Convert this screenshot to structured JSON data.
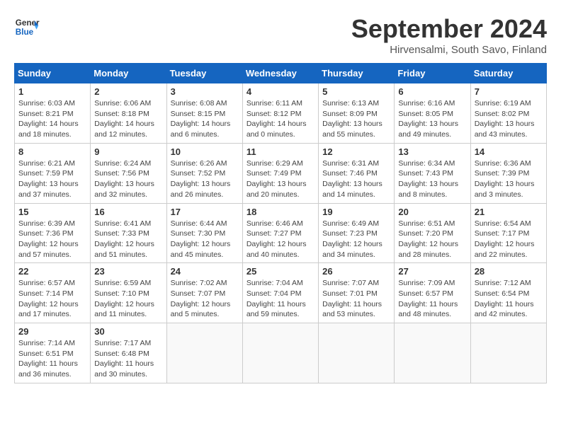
{
  "header": {
    "logo_line1": "General",
    "logo_line2": "Blue",
    "month": "September 2024",
    "location": "Hirvensalmi, South Savo, Finland"
  },
  "weekdays": [
    "Sunday",
    "Monday",
    "Tuesday",
    "Wednesday",
    "Thursday",
    "Friday",
    "Saturday"
  ],
  "weeks": [
    [
      {
        "day": "1",
        "info": "Sunrise: 6:03 AM\nSunset: 8:21 PM\nDaylight: 14 hours\nand 18 minutes."
      },
      {
        "day": "2",
        "info": "Sunrise: 6:06 AM\nSunset: 8:18 PM\nDaylight: 14 hours\nand 12 minutes."
      },
      {
        "day": "3",
        "info": "Sunrise: 6:08 AM\nSunset: 8:15 PM\nDaylight: 14 hours\nand 6 minutes."
      },
      {
        "day": "4",
        "info": "Sunrise: 6:11 AM\nSunset: 8:12 PM\nDaylight: 14 hours\nand 0 minutes."
      },
      {
        "day": "5",
        "info": "Sunrise: 6:13 AM\nSunset: 8:09 PM\nDaylight: 13 hours\nand 55 minutes."
      },
      {
        "day": "6",
        "info": "Sunrise: 6:16 AM\nSunset: 8:05 PM\nDaylight: 13 hours\nand 49 minutes."
      },
      {
        "day": "7",
        "info": "Sunrise: 6:19 AM\nSunset: 8:02 PM\nDaylight: 13 hours\nand 43 minutes."
      }
    ],
    [
      {
        "day": "8",
        "info": "Sunrise: 6:21 AM\nSunset: 7:59 PM\nDaylight: 13 hours\nand 37 minutes."
      },
      {
        "day": "9",
        "info": "Sunrise: 6:24 AM\nSunset: 7:56 PM\nDaylight: 13 hours\nand 32 minutes."
      },
      {
        "day": "10",
        "info": "Sunrise: 6:26 AM\nSunset: 7:52 PM\nDaylight: 13 hours\nand 26 minutes."
      },
      {
        "day": "11",
        "info": "Sunrise: 6:29 AM\nSunset: 7:49 PM\nDaylight: 13 hours\nand 20 minutes."
      },
      {
        "day": "12",
        "info": "Sunrise: 6:31 AM\nSunset: 7:46 PM\nDaylight: 13 hours\nand 14 minutes."
      },
      {
        "day": "13",
        "info": "Sunrise: 6:34 AM\nSunset: 7:43 PM\nDaylight: 13 hours\nand 8 minutes."
      },
      {
        "day": "14",
        "info": "Sunrise: 6:36 AM\nSunset: 7:39 PM\nDaylight: 13 hours\nand 3 minutes."
      }
    ],
    [
      {
        "day": "15",
        "info": "Sunrise: 6:39 AM\nSunset: 7:36 PM\nDaylight: 12 hours\nand 57 minutes."
      },
      {
        "day": "16",
        "info": "Sunrise: 6:41 AM\nSunset: 7:33 PM\nDaylight: 12 hours\nand 51 minutes."
      },
      {
        "day": "17",
        "info": "Sunrise: 6:44 AM\nSunset: 7:30 PM\nDaylight: 12 hours\nand 45 minutes."
      },
      {
        "day": "18",
        "info": "Sunrise: 6:46 AM\nSunset: 7:27 PM\nDaylight: 12 hours\nand 40 minutes."
      },
      {
        "day": "19",
        "info": "Sunrise: 6:49 AM\nSunset: 7:23 PM\nDaylight: 12 hours\nand 34 minutes."
      },
      {
        "day": "20",
        "info": "Sunrise: 6:51 AM\nSunset: 7:20 PM\nDaylight: 12 hours\nand 28 minutes."
      },
      {
        "day": "21",
        "info": "Sunrise: 6:54 AM\nSunset: 7:17 PM\nDaylight: 12 hours\nand 22 minutes."
      }
    ],
    [
      {
        "day": "22",
        "info": "Sunrise: 6:57 AM\nSunset: 7:14 PM\nDaylight: 12 hours\nand 17 minutes."
      },
      {
        "day": "23",
        "info": "Sunrise: 6:59 AM\nSunset: 7:10 PM\nDaylight: 12 hours\nand 11 minutes."
      },
      {
        "day": "24",
        "info": "Sunrise: 7:02 AM\nSunset: 7:07 PM\nDaylight: 12 hours\nand 5 minutes."
      },
      {
        "day": "25",
        "info": "Sunrise: 7:04 AM\nSunset: 7:04 PM\nDaylight: 11 hours\nand 59 minutes."
      },
      {
        "day": "26",
        "info": "Sunrise: 7:07 AM\nSunset: 7:01 PM\nDaylight: 11 hours\nand 53 minutes."
      },
      {
        "day": "27",
        "info": "Sunrise: 7:09 AM\nSunset: 6:57 PM\nDaylight: 11 hours\nand 48 minutes."
      },
      {
        "day": "28",
        "info": "Sunrise: 7:12 AM\nSunset: 6:54 PM\nDaylight: 11 hours\nand 42 minutes."
      }
    ],
    [
      {
        "day": "29",
        "info": "Sunrise: 7:14 AM\nSunset: 6:51 PM\nDaylight: 11 hours\nand 36 minutes."
      },
      {
        "day": "30",
        "info": "Sunrise: 7:17 AM\nSunset: 6:48 PM\nDaylight: 11 hours\nand 30 minutes."
      },
      {
        "day": "",
        "info": ""
      },
      {
        "day": "",
        "info": ""
      },
      {
        "day": "",
        "info": ""
      },
      {
        "day": "",
        "info": ""
      },
      {
        "day": "",
        "info": ""
      }
    ]
  ]
}
